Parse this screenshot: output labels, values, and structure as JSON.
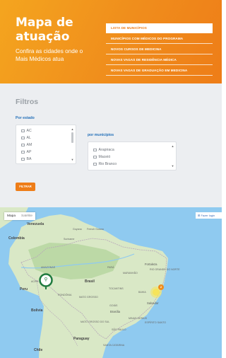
{
  "hero": {
    "title": "Mapa de atuação",
    "subtitle": "Confira as cidades onde o Mais Médicos atua",
    "nav": [
      {
        "label": "LISTA DE MUNICÍPIOS",
        "active": true
      },
      {
        "label": "MUNICÍPIOS COM MÉDICOS DO PROGRAMA",
        "active": false
      },
      {
        "label": "NOVOS CURSOS DE MEDICINA",
        "active": false
      },
      {
        "label": "NOVAS VAGAS DE RESIDÊNCIA MÉDICA",
        "active": false
      },
      {
        "label": "NOVAS VAGAS DE GRADUAÇÃO EM MEDICINA",
        "active": false
      }
    ]
  },
  "filters": {
    "title": "Filtros",
    "state_label": "Por estado",
    "states": [
      "AC",
      "AL",
      "AM",
      "AP",
      "BA"
    ],
    "municipality_label": "por municípios",
    "municipalities": [
      "Arapiraca",
      "Maceió",
      "Rio Branco"
    ],
    "filter_button": "FILTRAR"
  },
  "map": {
    "type_buttons": [
      "Mapa",
      "Satélite"
    ],
    "active_type": "Mapa",
    "login_button": "Fazer login",
    "labels": {
      "venezuela": "Venezuela",
      "colombia": "Colombia",
      "guyana": "Guyana",
      "suriname": "Suriname",
      "french_guiana": "French Guiana",
      "peru": "Peru",
      "brasil": "Brasil",
      "bolivia": "Bolivia",
      "paraguay": "Paraguay",
      "chile": "Chile",
      "amazonas": "AMAZONAS",
      "para": "PARÁ",
      "maranhao": "MARANHÃO",
      "rondonia": "RONDÔNIA",
      "tocantins": "TOCANTINS",
      "bahia": "BAHIA",
      "mato_grosso": "MATO GROSSO",
      "goias": "GOIÁS",
      "brasilia": "Brasília",
      "fortaleza": "Fortaleza",
      "salvador": "Salvador",
      "minas_gerais": "MINAS GERAIS",
      "espirito_santo": "ESPÍRITO SANTO",
      "mato_grosso_do_sul": "MATO GROSSO DO SUL",
      "sao_paulo": "SÃO PAULO",
      "santa_catarina": "SANTA CATARINA",
      "acre": "ACRE",
      "rio_grande_do_norte": "RIO GRANDE DO NORTE"
    },
    "cluster_count": "2",
    "colors": {
      "water": "#8fcaf0",
      "land": "#d9e8c6",
      "forest": "#bcd9a6",
      "marker_green": "#1f7a3e",
      "cluster_yellow": "#f6e45a",
      "cluster_orange": "#f08d1c"
    }
  }
}
